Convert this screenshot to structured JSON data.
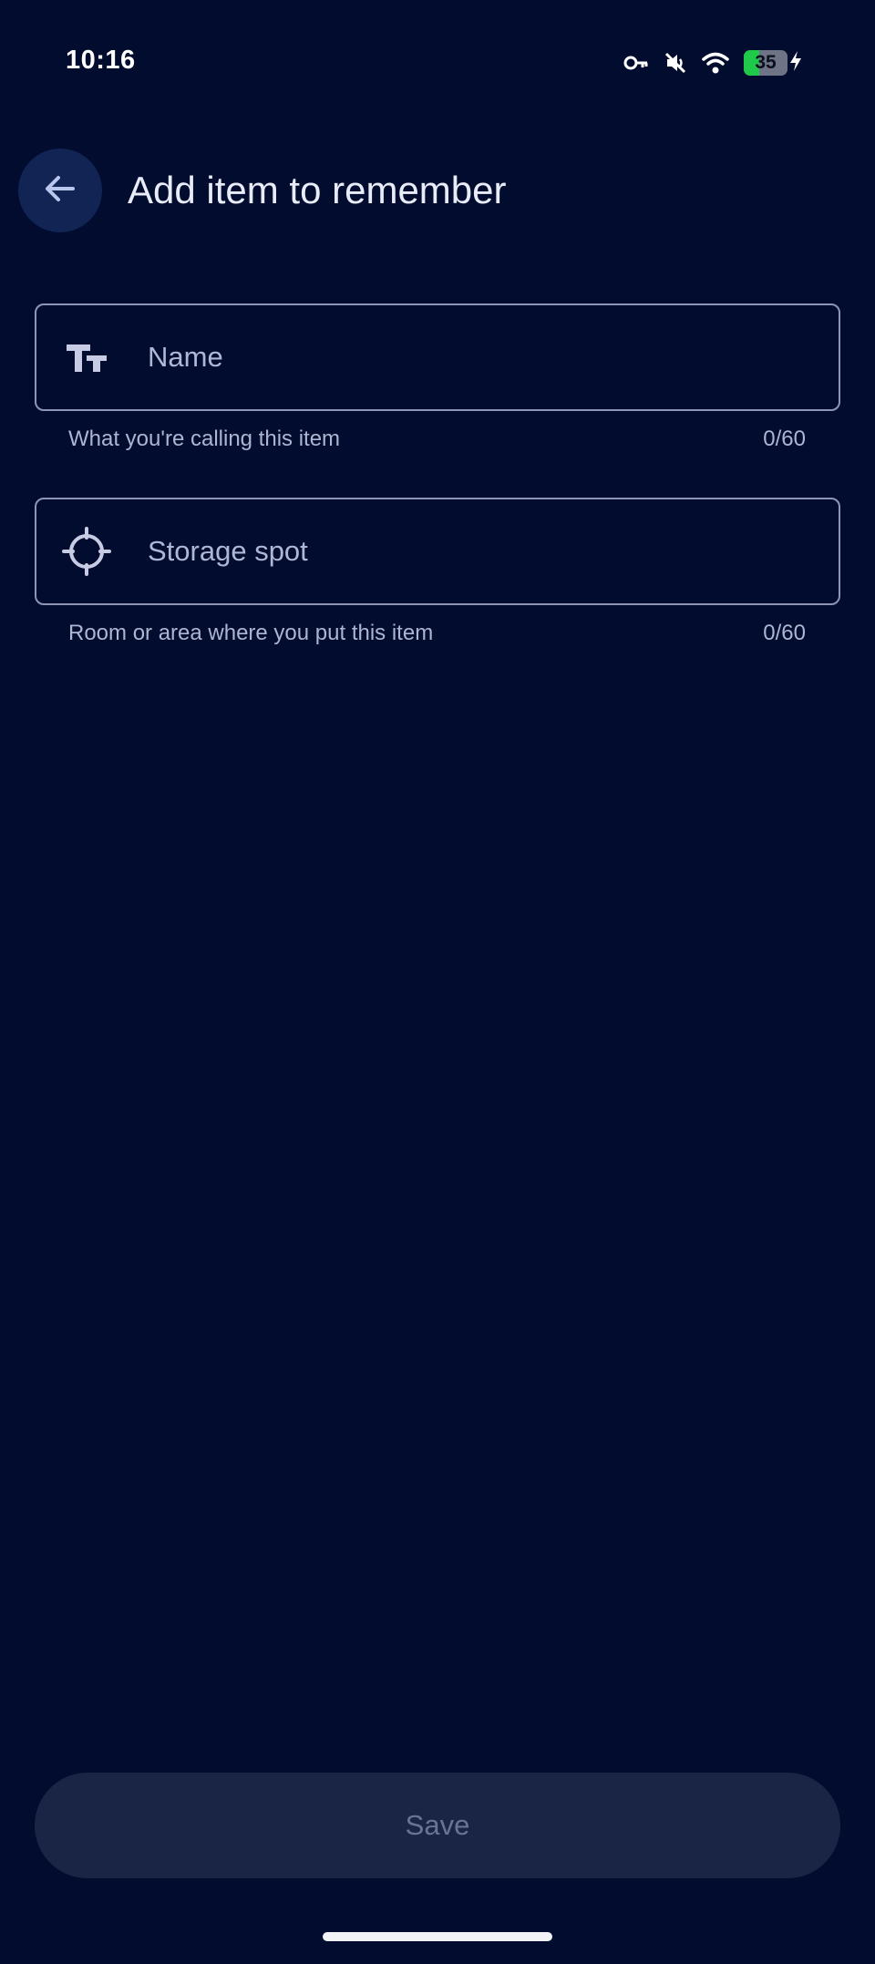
{
  "status_bar": {
    "time": "10:16",
    "icons": [
      "vpn-key-icon",
      "mute-icon",
      "wifi-icon",
      "battery-icon",
      "charging-bolt-icon"
    ],
    "battery_level": "35",
    "battery_fraction": 0.35
  },
  "app_bar": {
    "back_icon": "arrow-left-icon",
    "title": "Add item to remember"
  },
  "form": {
    "name_field": {
      "icon": "text-fields-icon",
      "placeholder": "Name",
      "value": "",
      "helper": "What you're calling this item",
      "counter": "0/60"
    },
    "storage_field": {
      "icon": "location-crosshair-icon",
      "placeholder": "Storage spot",
      "value": "",
      "helper": "Room or area where you put this item",
      "counter": "0/60"
    }
  },
  "actions": {
    "save_label": "Save"
  },
  "colors": {
    "background": "#010C2E",
    "back_button_bg": "#112454",
    "field_border": "#8E95B5",
    "save_button_bg": "#1A2545",
    "save_button_text": "#6B7394",
    "battery_green": "#1FC94A"
  }
}
